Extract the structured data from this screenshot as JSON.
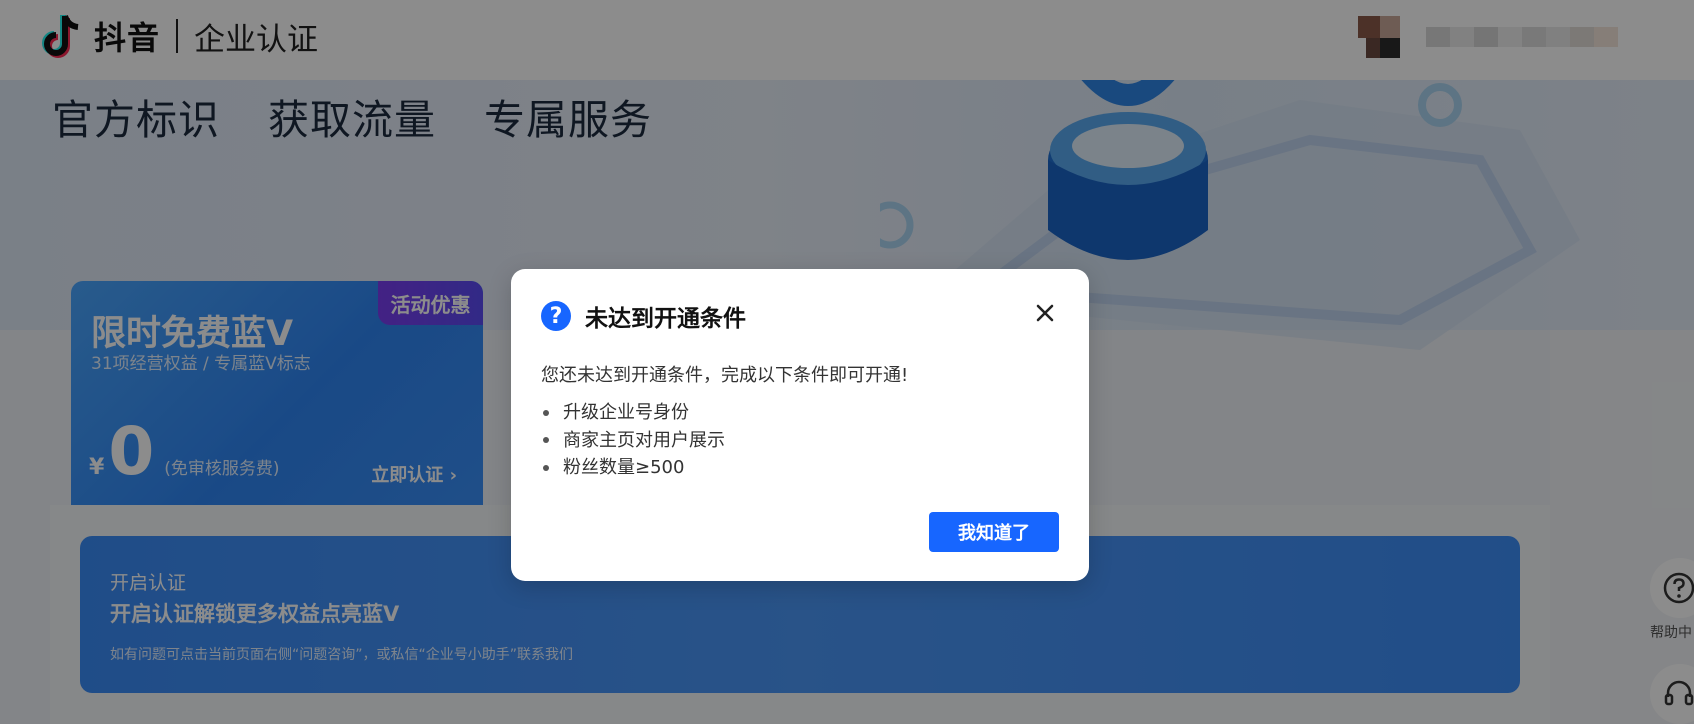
{
  "header": {
    "brand": "抖音",
    "subtitle": "企业认证"
  },
  "hero": {
    "tabs": [
      "官方标识",
      "获取流量",
      "专属服务"
    ]
  },
  "promo": {
    "badge": "活动优惠",
    "title": "限时免费蓝V",
    "subtitle": "31项经营权益 / 专属蓝V标志",
    "currency": "¥",
    "amount": "0",
    "note": "(免审核服务费)",
    "action": "立即认证 ›"
  },
  "banner": {
    "small": "开启认证",
    "title": "开启认证解锁更多权益点亮蓝V",
    "note": "如有问题可点击当前页面右侧“问题咨询”，或私信“企业号小助手”联系我们"
  },
  "side": {
    "help_label": "帮助中"
  },
  "modal": {
    "title": "未达到开通条件",
    "description": "您还未达到开通条件，完成以下条件即可开通!",
    "conditions": [
      "升级企业号身份",
      "商家主页对用户展示",
      "粉丝数量≥500"
    ],
    "confirm_label": "我知道了"
  },
  "colors": {
    "primary": "#1766ff",
    "promo_blue": "#3a8ff7",
    "badge_purple": "#7b3df1",
    "overlay": "rgba(0,0,0,0.45)"
  },
  "icons": {
    "logo": "douyin-logo-icon",
    "question": "question-icon",
    "close": "close-icon",
    "help": "help-circle-icon",
    "service": "headset-icon"
  }
}
